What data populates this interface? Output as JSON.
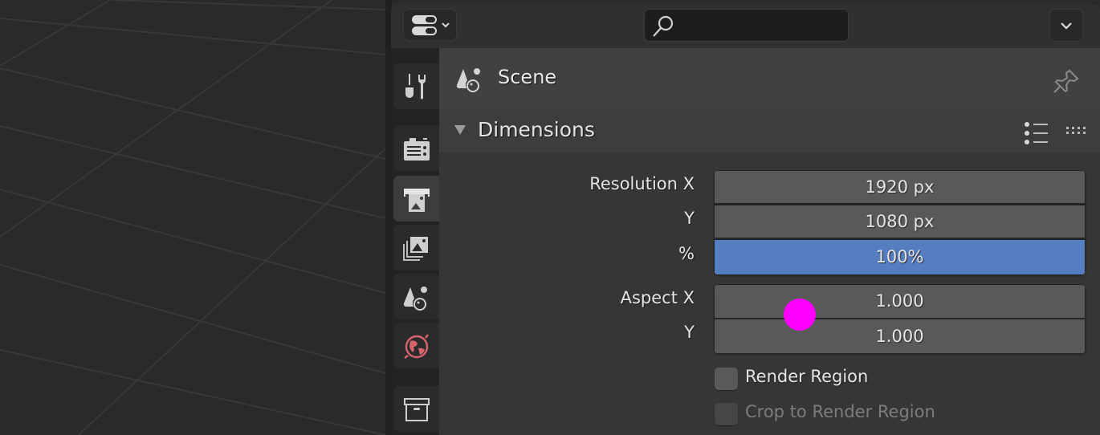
{
  "viewport": {
    "description": "3D viewport floor grid"
  },
  "header": {
    "editor_type_icon": "properties-editor-icon",
    "search": {
      "placeholder": "",
      "value": "",
      "icon": "search-icon"
    },
    "options_icon": "chevron-down-icon"
  },
  "tabs": [
    {
      "id": "tool",
      "icon": "tool-icon",
      "active": false
    },
    {
      "id": "render",
      "icon": "render-camera-icon",
      "active": false
    },
    {
      "id": "output",
      "icon": "output-printer-icon",
      "active": true
    },
    {
      "id": "view-layer",
      "icon": "view-layer-icon",
      "active": false
    },
    {
      "id": "scene",
      "icon": "scene-icon",
      "active": false
    },
    {
      "id": "world",
      "icon": "world-icon",
      "active": false
    },
    {
      "id": "collection",
      "icon": "collection-box-icon",
      "active": false
    }
  ],
  "context": {
    "label": "Scene",
    "icon": "scene-icon",
    "pin_icon": "pin-icon"
  },
  "panel": {
    "title": "Dimensions",
    "expanded": true,
    "presets_icon": "presets-list-icon",
    "drag_icon": "drag-handle-icon",
    "resolution": {
      "x_label": "Resolution X",
      "x_value": "1920 px",
      "y_label": "Y",
      "y_value": "1080 px",
      "percent_label": "%",
      "percent_value": "100%"
    },
    "aspect": {
      "x_label": "Aspect X",
      "x_value": "1.000",
      "y_label": "Y",
      "y_value": "1.000"
    },
    "render_region": {
      "label": "Render Region",
      "checked": false
    },
    "crop_region": {
      "label": "Crop to Render Region",
      "checked": false,
      "enabled": false
    }
  },
  "colors": {
    "accent_blue": "#557ec1",
    "world_icon": "#d9646e",
    "cursor_marker": "#ff00ff"
  }
}
